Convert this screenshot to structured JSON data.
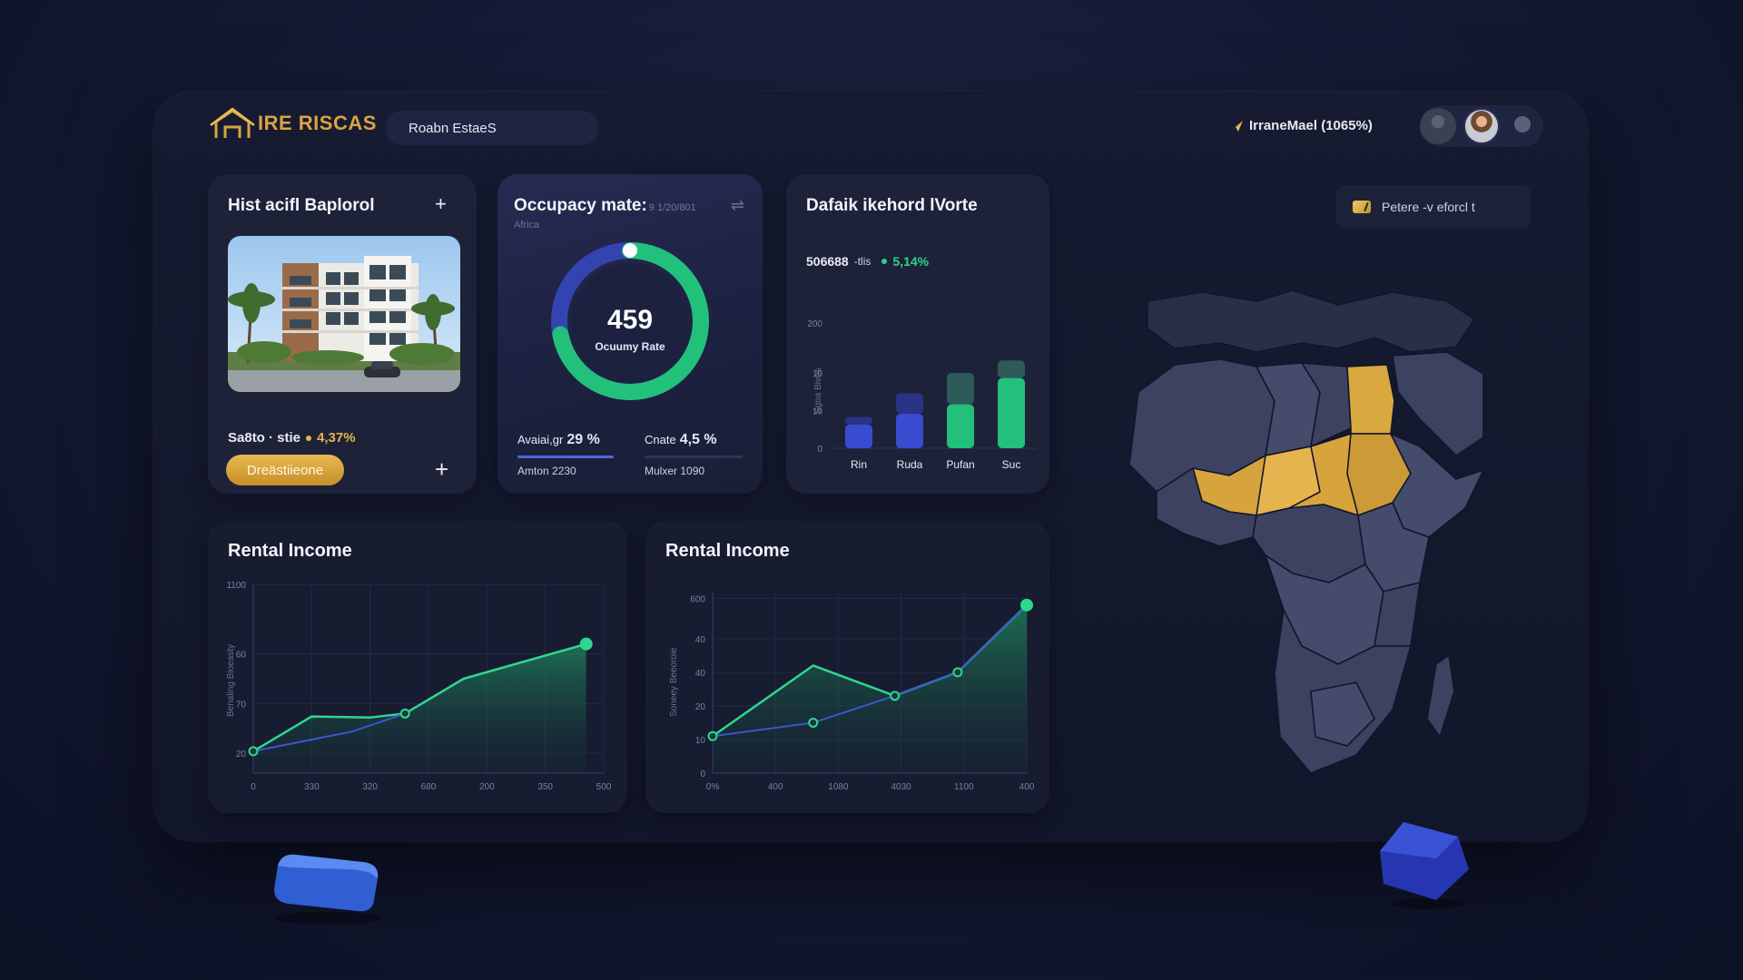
{
  "header": {
    "logo_text": "IRE RISCAS",
    "search_text": "Roabn EstaeS",
    "stat_text": "IrraneMael (1065%)"
  },
  "property_card": {
    "title": "Hist acifl Baplorol",
    "location": "Sa8to · stie",
    "growth": "4,37%",
    "button_label": "Dreästiieone",
    "add_icon": "plus-icon"
  },
  "occupancy_card": {
    "title": "Occupacy mate:",
    "date": "9 1/20/801",
    "region": "Africa",
    "donut_value": "459",
    "donut_label": "Ocuumy Rate",
    "donut_fraction": 0.72,
    "left_stat_label": "Avaiai,gr",
    "left_stat_value": "29 %",
    "left_stat_sub": "Amton 2230",
    "left_bar_fraction": 1.0,
    "right_stat_label": "Cnate",
    "right_stat_value": "4,5 %",
    "right_stat_sub": "Mulxer 1090",
    "right_bar_fraction": 0.0
  },
  "bar_card": {
    "title": "Dafaik ikehord lVorte",
    "kpi_value": "506688",
    "kpi_unit": "-tlis",
    "kpi_change": "5,14%",
    "ylabel": "Sgoa Bivos"
  },
  "right_panel": {
    "legend_label": "Petere -v eforcl t"
  },
  "income_left": {
    "title": "Rental Income",
    "ylabel": "Benaling Bioeasty"
  },
  "income_right": {
    "title": "Rental Income",
    "ylabel": "Soneey Beeoroie"
  },
  "colors": {
    "accent_gold": "#e6b54a",
    "accent_green": "#2dd48a",
    "accent_blue": "#4b5fe0",
    "panel": "#1d2239"
  },
  "chart_data": [
    {
      "type": "bar",
      "categories": [
        "Rin",
        "Ruda",
        "Pufan",
        "Suc"
      ],
      "series": [
        {
          "values": [
            38,
            55,
            70,
            112
          ]
        },
        {
          "values": [
            12,
            33,
            50,
            28
          ]
        }
      ],
      "stacked": true,
      "ylim": [
        0,
        220
      ],
      "yticks": [
        {
          "v": 0,
          "label": "0"
        },
        {
          "v": 60,
          "label": "10"
        },
        {
          "v": 120,
          "label": "10"
        },
        {
          "v": 200,
          "label": "200"
        }
      ],
      "grid": false
    },
    {
      "type": "line",
      "title": "Rental Income",
      "xticks": [
        "0",
        "330",
        "320",
        "680",
        "200",
        "350",
        "500"
      ],
      "yticks": [
        {
          "v": 20,
          "label": "20"
        },
        {
          "v": 70,
          "label": "70"
        },
        {
          "v": 120,
          "label": "60"
        },
        {
          "v": 190,
          "label": "1100"
        }
      ],
      "ylim": [
        0,
        190
      ],
      "xlim": [
        0,
        6
      ],
      "series": [
        {
          "points": [
            [
              0,
              22
            ],
            [
              1,
              57
            ],
            [
              2,
              56
            ],
            [
              2.6,
              60
            ],
            [
              3.6,
              95
            ],
            [
              5.7,
              130
            ]
          ],
          "style": "green-area"
        },
        {
          "points": [
            [
              0,
              22
            ],
            [
              1.7,
              42
            ],
            [
              2.6,
              60
            ]
          ],
          "style": "blue"
        }
      ],
      "markers": [
        [
          0,
          22
        ],
        [
          2.6,
          60
        ],
        [
          5.7,
          130
        ]
      ],
      "grid": true
    },
    {
      "type": "line",
      "title": "Rental Income",
      "xticks": [
        "0%",
        "400",
        "1080",
        "4030",
        "1100",
        "400"
      ],
      "yticks": [
        {
          "v": 0,
          "label": "0"
        },
        {
          "v": 10,
          "label": "10"
        },
        {
          "v": 20,
          "label": "20"
        },
        {
          "v": 30,
          "label": "40"
        },
        {
          "v": 40,
          "label": "40"
        },
        {
          "v": 52,
          "label": "600"
        }
      ],
      "ylim": [
        0,
        54
      ],
      "xlim": [
        0,
        5
      ],
      "series": [
        {
          "points": [
            [
              0,
              11
            ],
            [
              1.6,
              32
            ],
            [
              2.9,
              23
            ],
            [
              3.9,
              30
            ],
            [
              5,
              50
            ]
          ],
          "style": "green-area"
        },
        {
          "points": [
            [
              0,
              11
            ],
            [
              1.6,
              15
            ],
            [
              2.9,
              23
            ],
            [
              3.9,
              30
            ],
            [
              5,
              50
            ]
          ],
          "style": "blue"
        }
      ],
      "markers": [
        [
          0,
          11
        ],
        [
          1.6,
          15
        ],
        [
          2.9,
          23
        ],
        [
          3.9,
          30
        ],
        [
          5,
          50
        ]
      ],
      "grid": true
    }
  ]
}
